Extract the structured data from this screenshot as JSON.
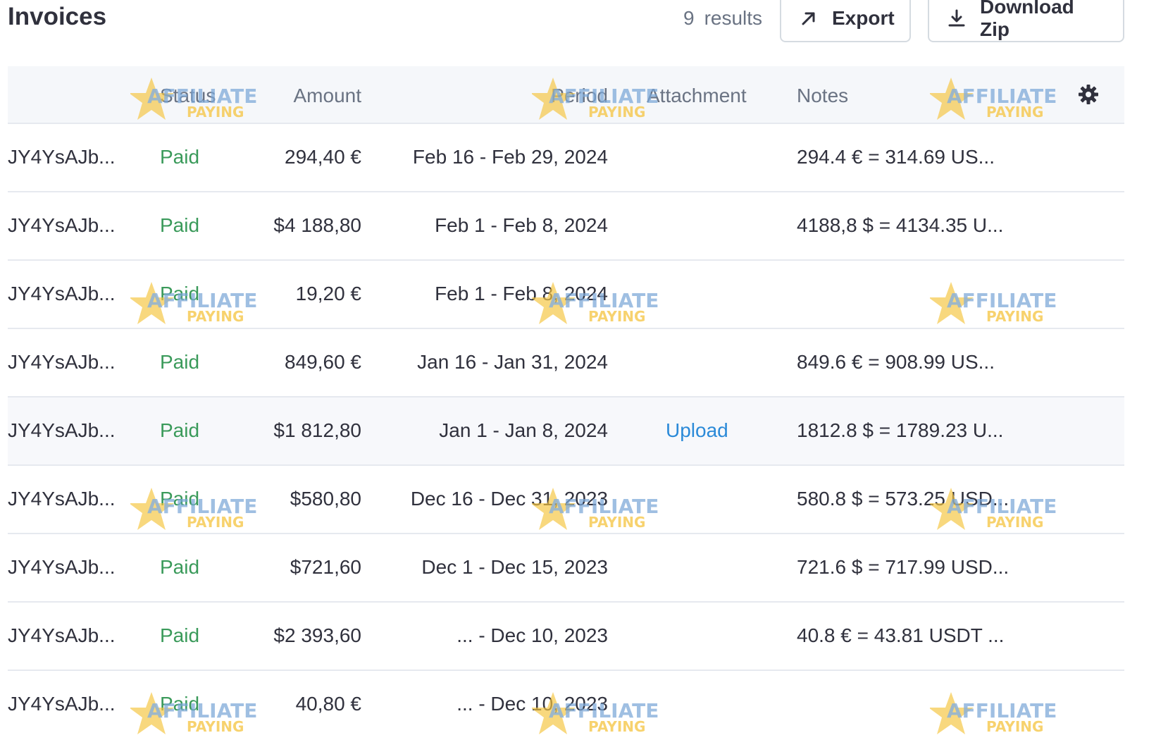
{
  "header": {
    "title": "Invoices",
    "results_count": "9",
    "results_label": "results",
    "export_label": "Export",
    "download_label": "Download Zip"
  },
  "columns": {
    "id": "",
    "status": "Status",
    "amount": "Amount",
    "period": "Period",
    "attachment": "Attachment",
    "notes": "Notes"
  },
  "rows": [
    {
      "id": "JY4YsAJb...",
      "status": "Paid",
      "amount": "294,40 €",
      "period": "Feb 16 - Feb 29, 2024",
      "attachment": "",
      "notes": "294.4 € = 314.69 US..."
    },
    {
      "id": "JY4YsAJb...",
      "status": "Paid",
      "amount": "$4 188,80",
      "period": "Feb 1 - Feb 8, 2024",
      "attachment": "",
      "notes": "4188,8 $ = 4134.35 U..."
    },
    {
      "id": "JY4YsAJb...",
      "status": "Paid",
      "amount": "19,20 €",
      "period": "Feb 1 - Feb 8, 2024",
      "attachment": "",
      "notes": ""
    },
    {
      "id": "JY4YsAJb...",
      "status": "Paid",
      "amount": "849,60 €",
      "period": "Jan 16 - Jan 31, 2024",
      "attachment": "",
      "notes": "849.6 € = 908.99 US..."
    },
    {
      "id": "JY4YsAJb...",
      "status": "Paid",
      "amount": "$1 812,80",
      "period": "Jan 1 - Jan 8, 2024",
      "attachment": "Upload",
      "notes": "1812.8 $ = 1789.23 U..."
    },
    {
      "id": "JY4YsAJb...",
      "status": "Paid",
      "amount": "$580,80",
      "period": "Dec 16 - Dec 31, 2023",
      "attachment": "",
      "notes": "580.8 $ = 573.25 USD..."
    },
    {
      "id": "JY4YsAJb...",
      "status": "Paid",
      "amount": "$721,60",
      "period": "Dec 1 - Dec 15, 2023",
      "attachment": "",
      "notes": "721.6 $ = 717.99 USD..."
    },
    {
      "id": "JY4YsAJb...",
      "status": "Paid",
      "amount": "$2 393,60",
      "period": "... - Dec 10, 2023",
      "attachment": "",
      "notes": "40.8 € = 43.81 USDT ..."
    },
    {
      "id": "JY4YsAJb...",
      "status": "Paid",
      "amount": "40,80 €",
      "period": "... - Dec 10, 2023",
      "attachment": "",
      "notes": ""
    }
  ],
  "watermark": {
    "line1": "AFFILIATE",
    "line2": "PAYING",
    "color": "#f5c542"
  },
  "colors": {
    "paid": "#3a9a5a",
    "link": "#2b8ad8",
    "header_bg": "#f5f7fa",
    "muted": "#6a7383"
  }
}
